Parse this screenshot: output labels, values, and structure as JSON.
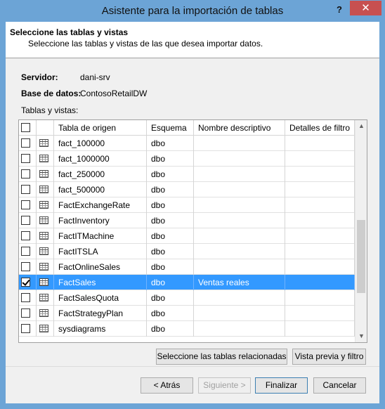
{
  "window": {
    "title": "Asistente para la importación de tablas",
    "help_glyph": "?",
    "close_glyph": "✕"
  },
  "header": {
    "title": "Seleccione las tablas y vistas",
    "subtitle": "Seleccione las tablas y vistas de las que desea importar datos."
  },
  "connection": {
    "server_label": "Servidor:",
    "server_value": "dani-srv",
    "database_label": "Base de datos:",
    "database_value": "ContosoRetailDW"
  },
  "grid": {
    "caption": "Tablas y vistas:",
    "columns": [
      "Tabla de origen",
      "Esquema",
      "Nombre descriptivo",
      "Detalles de filtro"
    ],
    "rows": [
      {
        "checked": false,
        "source": "fact_100000",
        "schema": "dbo",
        "friendly": "",
        "filter": "",
        "selected": false
      },
      {
        "checked": false,
        "source": "fact_1000000",
        "schema": "dbo",
        "friendly": "",
        "filter": "",
        "selected": false
      },
      {
        "checked": false,
        "source": "fact_250000",
        "schema": "dbo",
        "friendly": "",
        "filter": "",
        "selected": false
      },
      {
        "checked": false,
        "source": "fact_500000",
        "schema": "dbo",
        "friendly": "",
        "filter": "",
        "selected": false
      },
      {
        "checked": false,
        "source": "FactExchangeRate",
        "schema": "dbo",
        "friendly": "",
        "filter": "",
        "selected": false
      },
      {
        "checked": false,
        "source": "FactInventory",
        "schema": "dbo",
        "friendly": "",
        "filter": "",
        "selected": false
      },
      {
        "checked": false,
        "source": "FactITMachine",
        "schema": "dbo",
        "friendly": "",
        "filter": "",
        "selected": false
      },
      {
        "checked": false,
        "source": "FactITSLA",
        "schema": "dbo",
        "friendly": "",
        "filter": "",
        "selected": false
      },
      {
        "checked": false,
        "source": "FactOnlineSales",
        "schema": "dbo",
        "friendly": "",
        "filter": "",
        "selected": false
      },
      {
        "checked": true,
        "source": "FactSales",
        "schema": "dbo",
        "friendly": "Ventas reales",
        "filter": "",
        "selected": true
      },
      {
        "checked": false,
        "source": "FactSalesQuota",
        "schema": "dbo",
        "friendly": "",
        "filter": "",
        "selected": false
      },
      {
        "checked": false,
        "source": "FactStrategyPlan",
        "schema": "dbo",
        "friendly": "",
        "filter": "",
        "selected": false
      },
      {
        "checked": false,
        "source": "sysdiagrams",
        "schema": "dbo",
        "friendly": "",
        "filter": "",
        "selected": false
      }
    ],
    "scroll_up_glyph": "▲",
    "scroll_down_glyph": "▼"
  },
  "actions": {
    "related_tables": "Seleccione las tablas relacionadas",
    "preview_filter": "Vista previa y filtro"
  },
  "footer": {
    "back": "< Atrás",
    "next": "Siguiente >",
    "finish": "Finalizar",
    "cancel": "Cancelar"
  },
  "colors": {
    "title_bar": "#6ca4d6",
    "selection": "#3399ff",
    "close": "#c75050"
  }
}
